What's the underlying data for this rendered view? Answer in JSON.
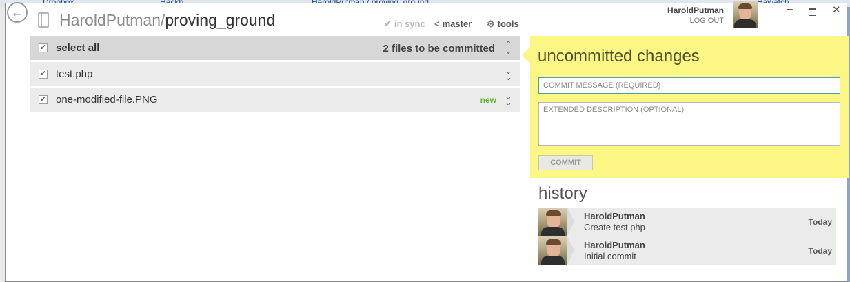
{
  "background": {
    "tab_dropbox": "Dropbox",
    "tab_hackb": "Hackb",
    "repo_link": "HaroldPutman / proving_ground",
    "hawatch": "Hawatch"
  },
  "header": {
    "repo_owner": "HaroldPutman/",
    "repo_name": "proving_ground",
    "sync_label": "in sync",
    "branch_label": "master",
    "tools_label": "tools"
  },
  "user": {
    "name": "HaroldPutman",
    "logout_label": "LOG OUT"
  },
  "window_controls": {
    "minimize": "–",
    "close": "✕"
  },
  "file_list": {
    "select_all_label": "select all",
    "commit_count_text": "2 files to be committed",
    "files": [
      {
        "name": "test.php",
        "status": ""
      },
      {
        "name": "one-modified-file.PNG",
        "status": "new"
      }
    ]
  },
  "commit_panel": {
    "title": "uncommitted changes",
    "message_placeholder": "COMMIT MESSAGE (REQUIRED)",
    "description_placeholder": "EXTENDED DESCRIPTION (OPTIONAL)",
    "commit_button": "COMMIT"
  },
  "history": {
    "title": "history",
    "items": [
      {
        "author": "HaroldPutman",
        "message": "Create test.php",
        "date": "Today"
      },
      {
        "author": "HaroldPutman",
        "message": "Initial commit",
        "date": "Today"
      }
    ]
  },
  "colors": {
    "commit_panel_bg": "#fcf684",
    "new_badge": "#5bb82f",
    "focus_border": "#4e9bb0"
  },
  "icons": {
    "back": "back-arrow-icon",
    "sync": "check-icon",
    "branch": "branch-icon",
    "tools": "gear-icon",
    "checkbox": "checkmark-icon",
    "expand": "chevron-double-icon"
  }
}
